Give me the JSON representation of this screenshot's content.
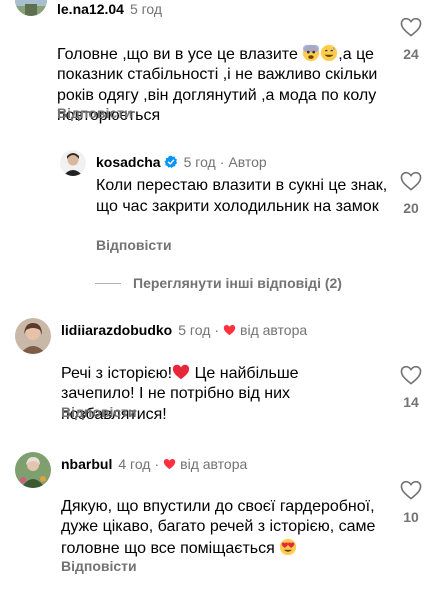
{
  "comments": [
    {
      "username": "le.na12.04",
      "time": "5 год",
      "text_before_emoji": "Головне ,що ви в усе це влазите ",
      "text_after_emoji": ",а це показник стабільності ,і не важливо скільки років одягу ,він доглянутий ,а мода по колу повторюється",
      "emojis": [
        "fearful-face",
        "grinning-sweat-face"
      ],
      "reply_label": "Відповісти",
      "likes": "24"
    },
    {
      "username": "kosadcha",
      "verified": true,
      "time": "5 год",
      "author_label": "Автор",
      "separator": "·",
      "text": "Коли перестаю влазити в сукні це знак, що час закрити холодильник на замок",
      "reply_label": "Відповісти",
      "likes": "20"
    },
    {
      "username": "lidiiarazdobudko",
      "time": "5 год",
      "separator": "·",
      "liked_by_author": "від автора",
      "text_before_emoji": "Речі з історією!",
      "text_after_emoji": " Це найбільше зачепило! І не потрібно від них позбавлятися!",
      "emojis": [
        "red-heart"
      ],
      "reply_label": "Відповісти",
      "likes": "14"
    },
    {
      "username": "nbarbul",
      "time": "4 год",
      "separator": "·",
      "liked_by_author": "від автора",
      "text": "Дякую, що впустили до своєї гардеробної, дуже цікаво, багато речей з історією, саме головне що все поміщається ",
      "emojis": [
        "heart-eyes-face"
      ],
      "reply_label": "Відповісти",
      "likes": "10"
    }
  ],
  "view_more_replies": "Переглянути інші відповіді (2)",
  "colors": {
    "secondary_text": "#737373",
    "heart_red": "#ff3040",
    "verified_blue": "#0095f6"
  }
}
